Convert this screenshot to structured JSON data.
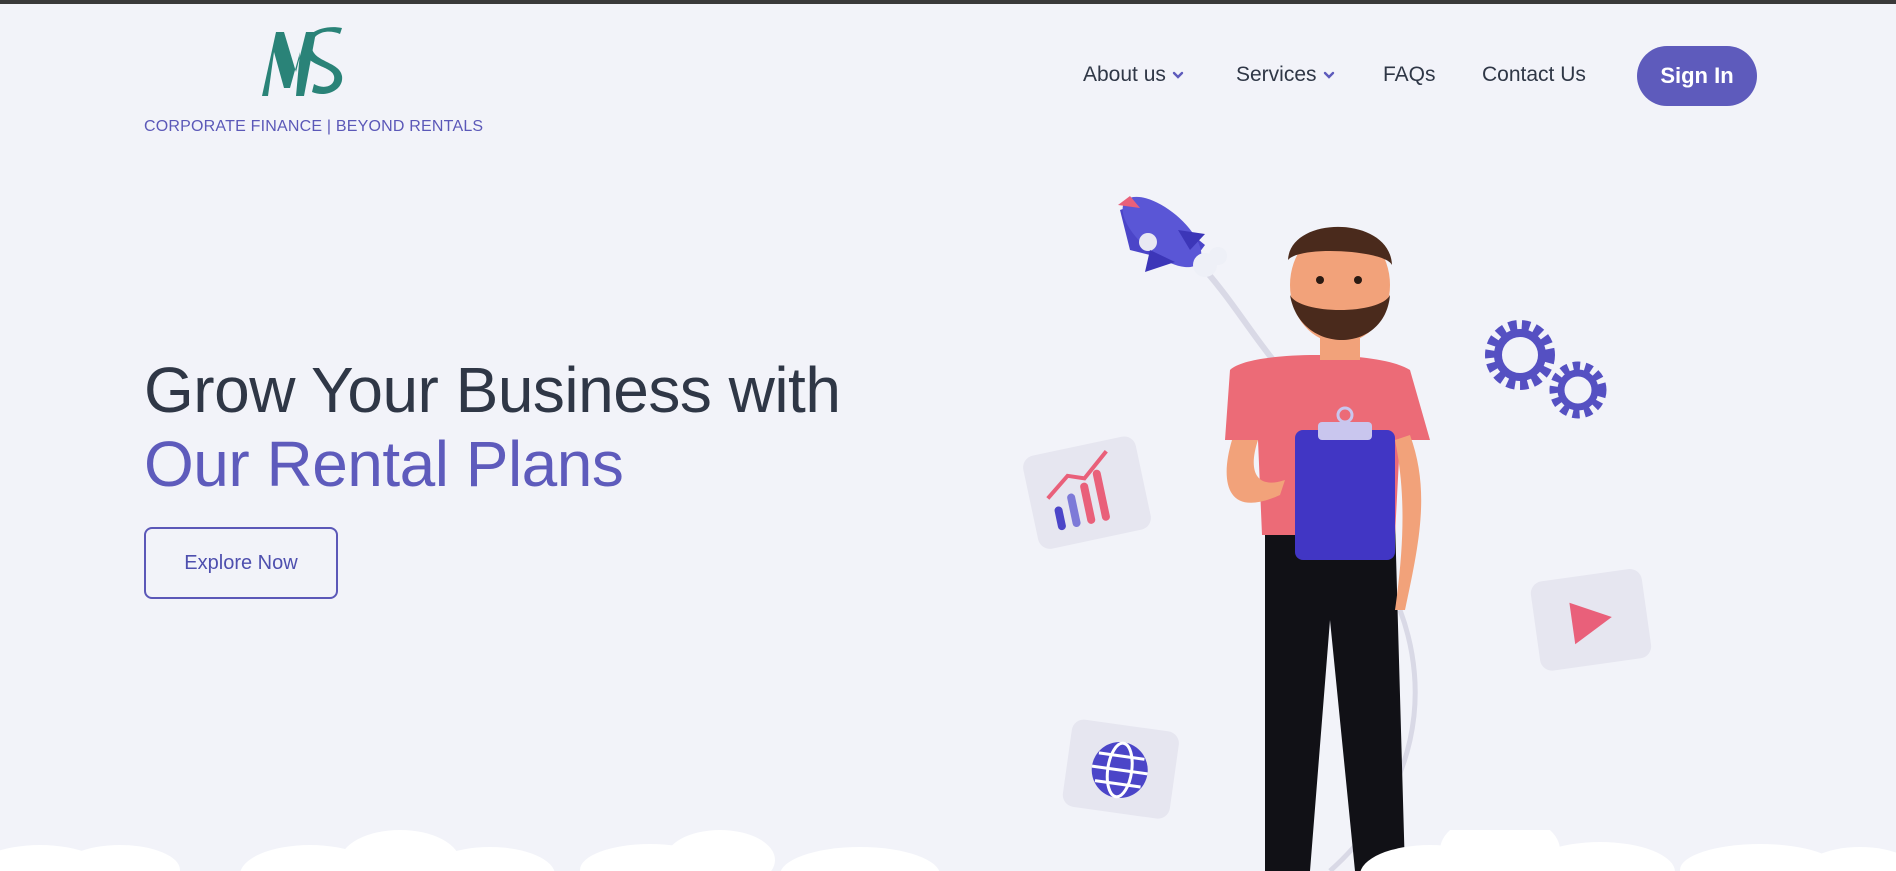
{
  "brand": {
    "logo_text": "MS",
    "tagline": "CORPORATE FINANCE | BEYOND RENTALS",
    "logo_color": "#2a8378"
  },
  "nav": {
    "items": [
      {
        "label": "About us",
        "has_dropdown": true
      },
      {
        "label": "Services",
        "has_dropdown": true
      },
      {
        "label": "FAQs",
        "has_dropdown": false
      },
      {
        "label": "Contact Us",
        "has_dropdown": false
      }
    ],
    "signin_label": "Sign In"
  },
  "hero": {
    "title_line1": "Grow Your Business with",
    "title_line2": "Our Rental Plans",
    "cta_label": "Explore Now"
  },
  "colors": {
    "background": "#f2f3f9",
    "accent": "#5e5bbc",
    "heading": "#2f3746"
  },
  "illustration": {
    "icons": [
      "rocket-icon",
      "gears-icon",
      "chart-card-icon",
      "play-card-icon",
      "globe-card-icon"
    ],
    "figure": "man-with-clipboard"
  }
}
